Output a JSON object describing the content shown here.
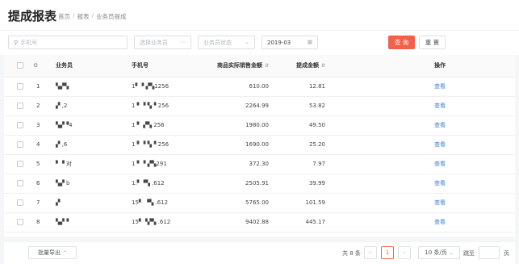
{
  "header": {
    "title": "提成报表",
    "breadcrumb": [
      "首页",
      "报表",
      "业务员提成"
    ],
    "breadcrumb_sep": "/"
  },
  "filters": {
    "phone_placeholder": "手机号",
    "salesperson_placeholder": "选择业务员",
    "status_placeholder": "业务员状态",
    "month_value": "2019-03",
    "search_label": "查 询",
    "reset_label": "重 置"
  },
  "table": {
    "columns": {
      "index_icon": "⚙",
      "salesperson": "业务员",
      "phone": "手机号",
      "sales_amount": "商品实际销售金额",
      "commission": "提成金额",
      "action": "操作"
    },
    "rows": [
      {
        "index": "1",
        "salesperson": "▚▞▚",
        "phone": "1▘▝ ▞▚1256",
        "sales": "610.00",
        "commission": "12.81",
        "action": "查看"
      },
      {
        "index": "2",
        "salesperson": "▞  ,2",
        "phone": "1 ▘▝ ▚▝ 256",
        "sales": "2264.99",
        "commission": "53.82",
        "action": "查看"
      },
      {
        "index": "3",
        "salesperson": "▚▞▝4",
        "phone": "1 ▘  ▞▚ 256",
        "sales": "1980.00",
        "commission": "49.50",
        "action": "查看"
      },
      {
        "index": "4",
        "salesperson": "▞  ,6",
        "phone": "1 ▘▝ ▚▝ 256",
        "sales": "1690.00",
        "commission": "25.20",
        "action": "查看"
      },
      {
        "index": "5",
        "salesperson": "▘▝  对",
        "phone": "1 ▘▝ ▞▚291",
        "sales": "372.30",
        "commission": "7.97",
        "action": "查看"
      },
      {
        "index": "6",
        "salesperson": "▚▞ b",
        "phone": "1.▘▝▚ .612",
        "sales": "2505.91",
        "commission": "39.99",
        "action": "查看"
      },
      {
        "index": "7",
        "salesperson": "▞",
        "phone": "15▘ ▝▚ .612",
        "sales": "5765.00",
        "commission": "101.59",
        "action": "查看"
      },
      {
        "index": "8",
        "salesperson": "▚▞▝",
        "phone": "15▘▝▞▚ .612",
        "sales": "9402.88",
        "commission": "445.17",
        "action": "查看"
      }
    ]
  },
  "footer": {
    "batch_export_label": "批量导出",
    "total_text": "共 8 条",
    "prev_symbol": "‹",
    "current_page": "1",
    "next_symbol": "›",
    "page_size": "10 条/页",
    "jump_label": "跳至",
    "page_suffix": "页"
  }
}
